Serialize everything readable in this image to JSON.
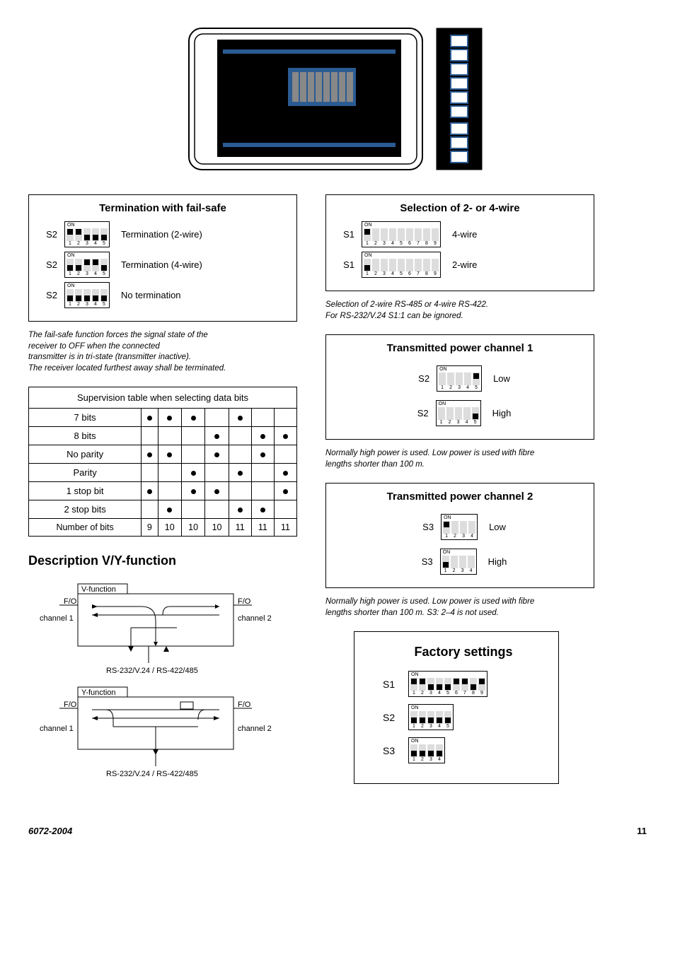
{
  "term_panel": {
    "title": "Termination with fail-safe",
    "rows": [
      {
        "label": "S2",
        "switches": [
          "up",
          "up",
          "down",
          "down",
          "down"
        ],
        "text": "Termination (2-wire)"
      },
      {
        "label": "S2",
        "switches": [
          "down",
          "down",
          "up",
          "up",
          "down"
        ],
        "text": "Termination (4-wire)"
      },
      {
        "label": "S2",
        "switches": [
          "down",
          "down",
          "down",
          "down",
          "down"
        ],
        "text": "No termination"
      }
    ],
    "caption_lines": [
      "The fail-safe function forces the signal state of the",
      "receiver to OFF when the connected",
      "transmitter is in tri-state (transmitter inactive).",
      "The receiver located furthest away shall be terminated."
    ]
  },
  "sup_table": {
    "title": "Supervision table when selecting data bits",
    "rows": [
      {
        "label": "7 bits",
        "cells": [
          "d",
          "d",
          "d",
          "",
          "d",
          "",
          ""
        ]
      },
      {
        "label": "8 bits",
        "cells": [
          "",
          "",
          "",
          "d",
          "",
          "d",
          "d"
        ]
      },
      {
        "label": "No parity",
        "cells": [
          "d",
          "d",
          "",
          "d",
          "",
          "d",
          ""
        ]
      },
      {
        "label": "Parity",
        "cells": [
          "",
          "",
          "d",
          "",
          "d",
          "",
          "d"
        ]
      },
      {
        "label": "1 stop bit",
        "cells": [
          "d",
          "",
          "d",
          "d",
          "",
          "",
          "d"
        ]
      },
      {
        "label": "2 stop bits",
        "cells": [
          "",
          "d",
          "",
          "",
          "d",
          "d",
          ""
        ]
      }
    ],
    "num_row": {
      "label": "Number of bits",
      "values": [
        "9",
        "10",
        "10",
        "10",
        "11",
        "11",
        "11"
      ]
    }
  },
  "vy": {
    "heading": "Description V/Y-function",
    "v_label": "V-function",
    "y_label": "Y-function",
    "fo": "F/O",
    "ch1": "channel 1",
    "ch2": "channel 2",
    "iface": "RS-232/V.24 / RS-422/485"
  },
  "wire_panel": {
    "title": "Selection of 2- or 4-wire",
    "rows": [
      {
        "label": "S1",
        "switches": [
          "up",
          "",
          "",
          "",
          "",
          "",
          "",
          "",
          ""
        ],
        "text": "4-wire"
      },
      {
        "label": "S1",
        "switches": [
          "down",
          "",
          "",
          "",
          "",
          "",
          "",
          "",
          ""
        ],
        "text": "2-wire"
      }
    ],
    "caption_lines": [
      "Selection of 2-wire RS-485 or 4-wire RS-422.",
      "For RS-232/V.24 S1:1 can be ignored."
    ]
  },
  "tx1_panel": {
    "title": "Transmitted power channel 1",
    "rows": [
      {
        "label": "S2",
        "switches": [
          "",
          "",
          "",
          "",
          "up"
        ],
        "text": "Low"
      },
      {
        "label": "S2",
        "switches": [
          "",
          "",
          "",
          "",
          "down"
        ],
        "text": "High"
      }
    ],
    "caption_lines": [
      "Normally high power is used. Low power is used with fibre",
      "lengths shorter than 100 m."
    ]
  },
  "tx2_panel": {
    "title": "Transmitted power channel 2",
    "rows": [
      {
        "label": "S3",
        "switches": [
          "up",
          "",
          "",
          ""
        ],
        "text": "Low"
      },
      {
        "label": "S3",
        "switches": [
          "down",
          "",
          "",
          ""
        ],
        "text": "High"
      }
    ],
    "caption_lines": [
      "Normally high power is used. Low power is used with fibre",
      "lengths shorter than 100 m. S3: 2–4 is not used."
    ]
  },
  "factory": {
    "title": "Factory settings",
    "rows": [
      {
        "label": "S1",
        "switches": [
          "up",
          "up",
          "down",
          "down",
          "down",
          "up",
          "up",
          "down",
          "up"
        ]
      },
      {
        "label": "S2",
        "switches": [
          "down",
          "down",
          "down",
          "down",
          "down"
        ]
      },
      {
        "label": "S3",
        "switches": [
          "down",
          "down",
          "down",
          "down"
        ]
      }
    ]
  },
  "footer": {
    "doc_id": "6072-2004",
    "page": "11"
  }
}
